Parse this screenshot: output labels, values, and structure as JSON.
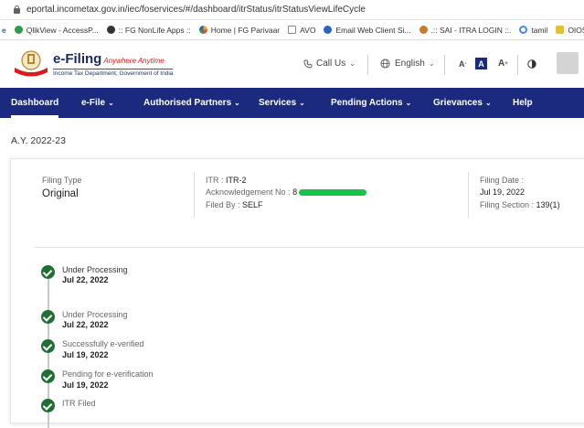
{
  "browser": {
    "url": "eportal.incometax.gov.in/iec/foservices/#/dashboard/itrStatus/itrStatusViewLifeCycle",
    "bookmarks": [
      {
        "label": "e",
        "color": "#2b63c7"
      },
      {
        "label": "QlikView - AccessP...",
        "color": "#2d9b4a"
      },
      {
        "label": ":: FG NonLife Apps ::",
        "color": "#333333"
      },
      {
        "label": "Home | FG Parivaar",
        "color": "#f4a51c"
      },
      {
        "label": "AVO",
        "color": "#8a8a8a"
      },
      {
        "label": "Email Web Client Si...",
        "color": "#2b63c7"
      },
      {
        "label": ".:: SAI - ITRA LOGIN ::.",
        "color": "#c97a2b"
      },
      {
        "label": "tamil",
        "color": "#4285f4"
      },
      {
        "label": "OIOS User",
        "color": "#e0c23a"
      }
    ]
  },
  "header": {
    "logo_title": "e-Filing",
    "logo_tagline": "Anywhere Anytime",
    "logo_sub": "Income Tax Department, Government of India",
    "call_us": "Call Us",
    "language": "English",
    "font_decrease": "A",
    "font_normal": "A",
    "font_increase": "A"
  },
  "nav": {
    "items": [
      "Dashboard",
      "e-File",
      "Authorised Partners",
      "Services",
      "Pending Actions",
      "Grievances",
      "Help"
    ]
  },
  "page": {
    "assessment_year": "A.Y. 2022-23",
    "filing_type_label": "Filing Type",
    "filing_type_value": "Original",
    "itr_label": "ITR :",
    "itr_value": "ITR-2",
    "ack_label": "Acknowledgement No :",
    "ack_value_prefix": "8",
    "filed_by_label": "Filed By :",
    "filed_by_value": "SELF",
    "filing_date_label": "Filing Date :",
    "filing_date_value": "Jul 19, 2022",
    "filing_section_label": "Filing Section :",
    "filing_section_value": "139(1)"
  },
  "timeline": [
    {
      "title": "Under Processing",
      "date": "Jul 22, 2022"
    },
    {
      "title": "Under Processing",
      "date": "Jul 22, 2022"
    },
    {
      "title": "Successfully e-verified",
      "date": "Jul 19, 2022"
    },
    {
      "title": "Pending for e-verification",
      "date": "Jul 19, 2022"
    },
    {
      "title": "ITR Filed",
      "date": ""
    }
  ],
  "colors": {
    "navbar": "#1b2a7e",
    "status_check": "#1f6e33",
    "redaction": "#19c24a"
  }
}
